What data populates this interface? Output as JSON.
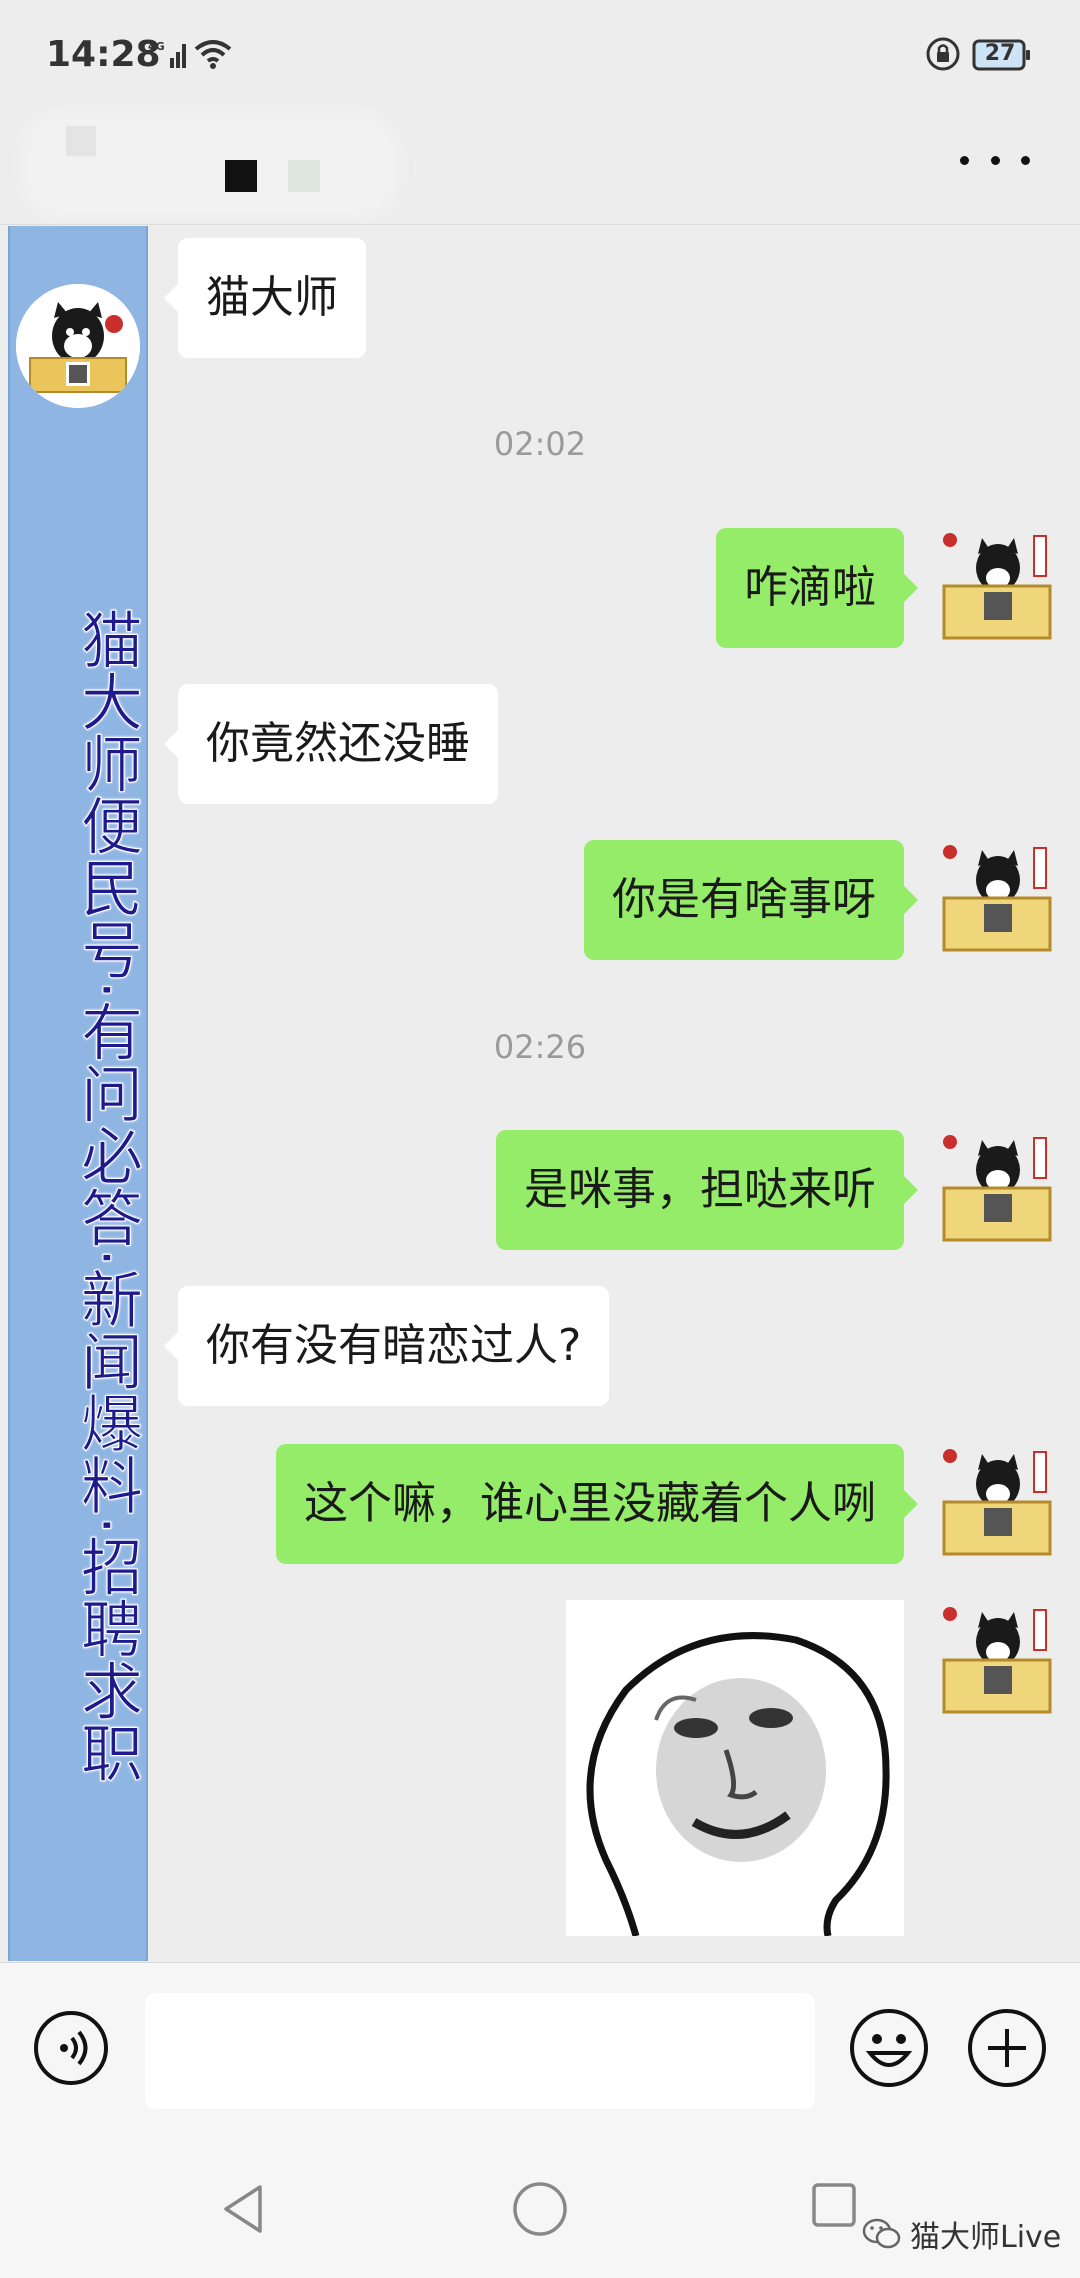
{
  "status_bar": {
    "time": "14:28",
    "network": "4G",
    "battery": "27"
  },
  "header": {
    "menu_icon": "more-dots-icon"
  },
  "side_banner": {
    "text": "猫大师便民号·有问必答·新闻爆料·招聘求职"
  },
  "messages": [
    {
      "type": "in",
      "text": "猫大师"
    },
    {
      "type": "time",
      "text": "02:02"
    },
    {
      "type": "out",
      "text": "咋滴啦"
    },
    {
      "type": "in",
      "text": "你竟然还没睡"
    },
    {
      "type": "out",
      "text": "你是有啥事呀"
    },
    {
      "type": "time",
      "text": "02:26"
    },
    {
      "type": "out",
      "text": "是咪事，担哒来听"
    },
    {
      "type": "in",
      "text": "你有没有暗恋过人?"
    },
    {
      "type": "out",
      "text": "这个嘛，谁心里没藏着个人咧"
    },
    {
      "type": "out_sticker",
      "text": ""
    }
  ],
  "input_bar": {
    "placeholder": "",
    "icons": [
      "voice-icon",
      "emoji-icon",
      "plus-icon"
    ]
  },
  "watermark": {
    "text": "猫大师Live"
  },
  "colors": {
    "out_bubble": "#95ec69",
    "in_bubble": "#ffffff",
    "banner": "#8fb5e3",
    "banner_text": "#1f1a8c"
  }
}
